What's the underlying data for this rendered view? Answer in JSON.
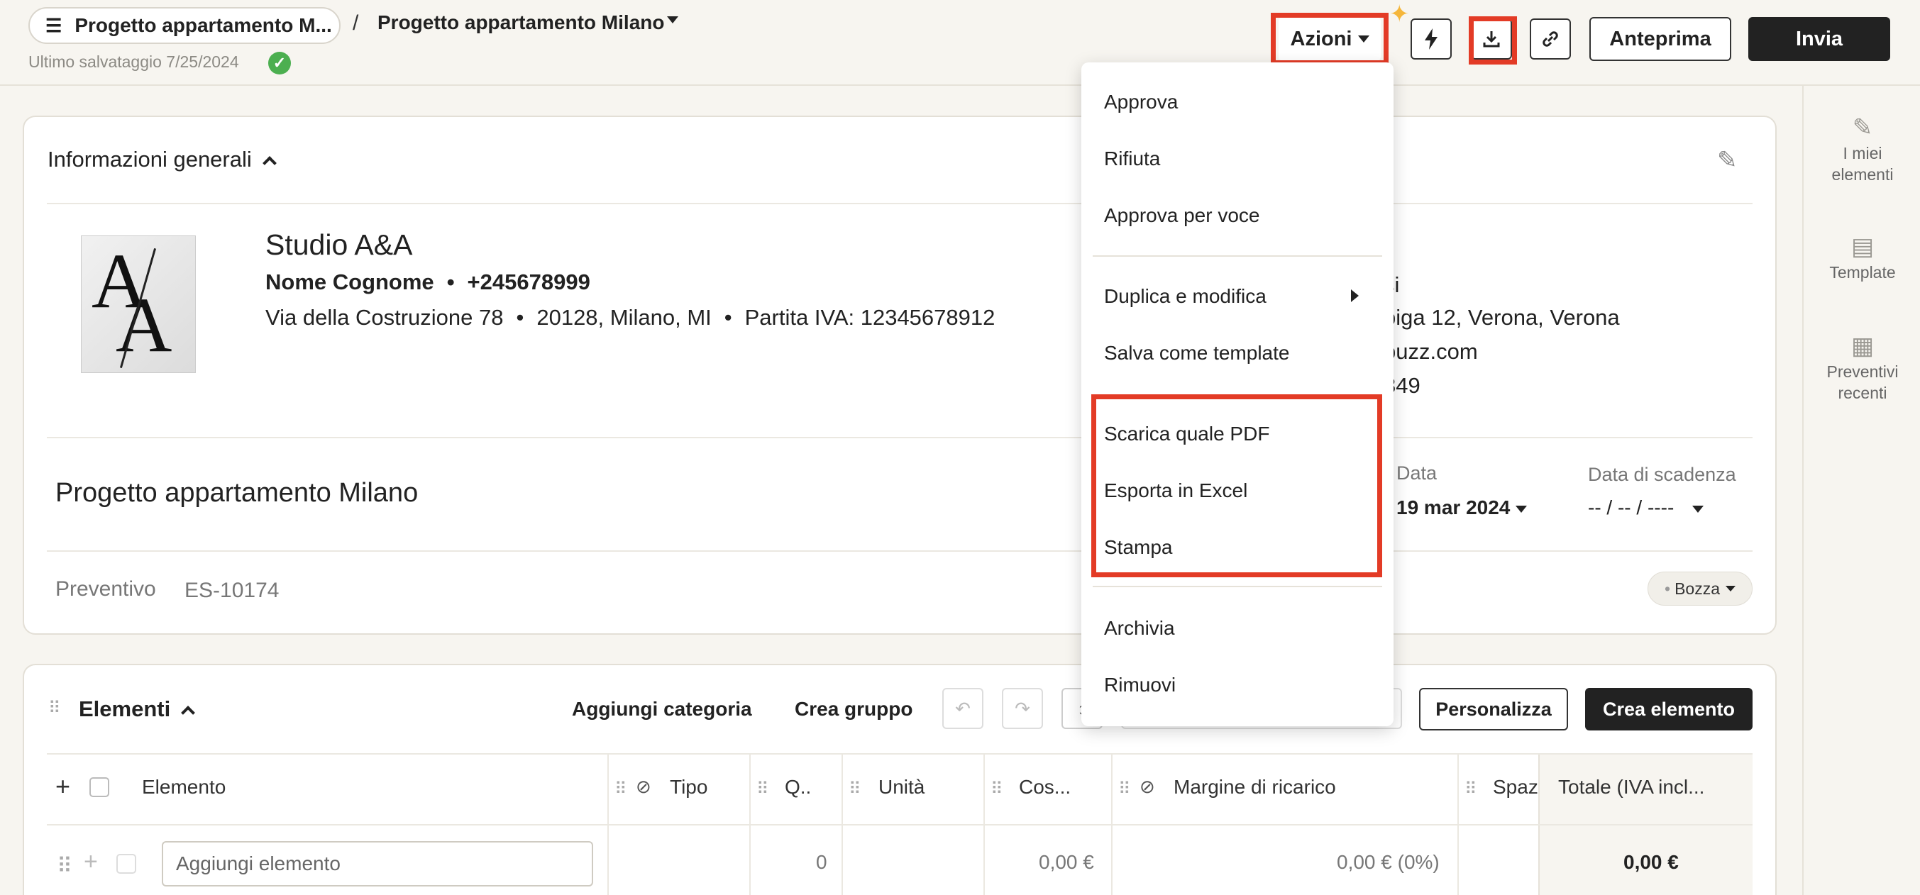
{
  "header": {
    "project_pill": "Progetto appartamento M...",
    "breadcrumb_sep": "/",
    "breadcrumb_current": "Progetto appartamento Milano",
    "last_saved": "Ultimo salvataggio 7/25/2024",
    "azioni_label": "Azioni",
    "preview_label": "Anteprima",
    "send_label": "Invia"
  },
  "sidebar_right": {
    "items": [
      {
        "label1": "I miei",
        "label2": "elementi",
        "icon": "tools-icon"
      },
      {
        "label1": "Template",
        "label2": "",
        "icon": "clipboard-icon"
      },
      {
        "label1": "Preventivi",
        "label2": "recenti",
        "icon": "calculator-icon"
      }
    ]
  },
  "general": {
    "title": "Informazioni generali",
    "company": "Studio A&A",
    "contact_name": "Nome Cognome",
    "phone": "+245678999",
    "street": "Via della Costruzione 78",
    "city": "20128, Milano, MI",
    "vat": "Partita IVA: 12345678912",
    "client_line1": "si",
    "client_line2": "pigа 12, Verona, Verona",
    "client_line3": "buzz.com",
    "client_line4": "849"
  },
  "project": {
    "title": "Progetto appartamento Milano",
    "date_label": "Data",
    "date_value": "19 mar 2024",
    "due_label": "Data di scadenza",
    "due_value": "-- / -- / ----",
    "doc_type": "Preventivo",
    "doc_number": "ES-10174",
    "status": "Bozza"
  },
  "menu": {
    "items": {
      "approve": "Approva",
      "reject": "Rifiuta",
      "approve_item": "Approva per voce",
      "duplicate": "Duplica e modifica",
      "save_template": "Salva come template",
      "download_pdf": "Scarica quale PDF",
      "export_excel": "Esporta in Excel",
      "print": "Stampa",
      "archive": "Archivia",
      "remove": "Rimuovi"
    }
  },
  "elements": {
    "title": "Elementi",
    "add_category": "Aggiungi categoria",
    "create_group": "Crea gruppo",
    "customize": "Personalizza",
    "create_element": "Crea elemento",
    "columns": {
      "element": "Elemento",
      "type": "Tipo",
      "qty": "Q..",
      "unit": "Unità",
      "cost": "Cos...",
      "markup": "Margine di ricarico",
      "space": "Spaz",
      "total": "Totale (IVA incl..."
    },
    "row": {
      "placeholder": "Aggiungi elemento",
      "qty": "0",
      "cost": "0,00 €",
      "markup": "0,00 € (0%)",
      "total": "0,00 €"
    }
  },
  "colors": {
    "accent_red": "#e33b26",
    "dark": "#222222",
    "success": "#4caf50",
    "background": "#f7f5f0"
  }
}
